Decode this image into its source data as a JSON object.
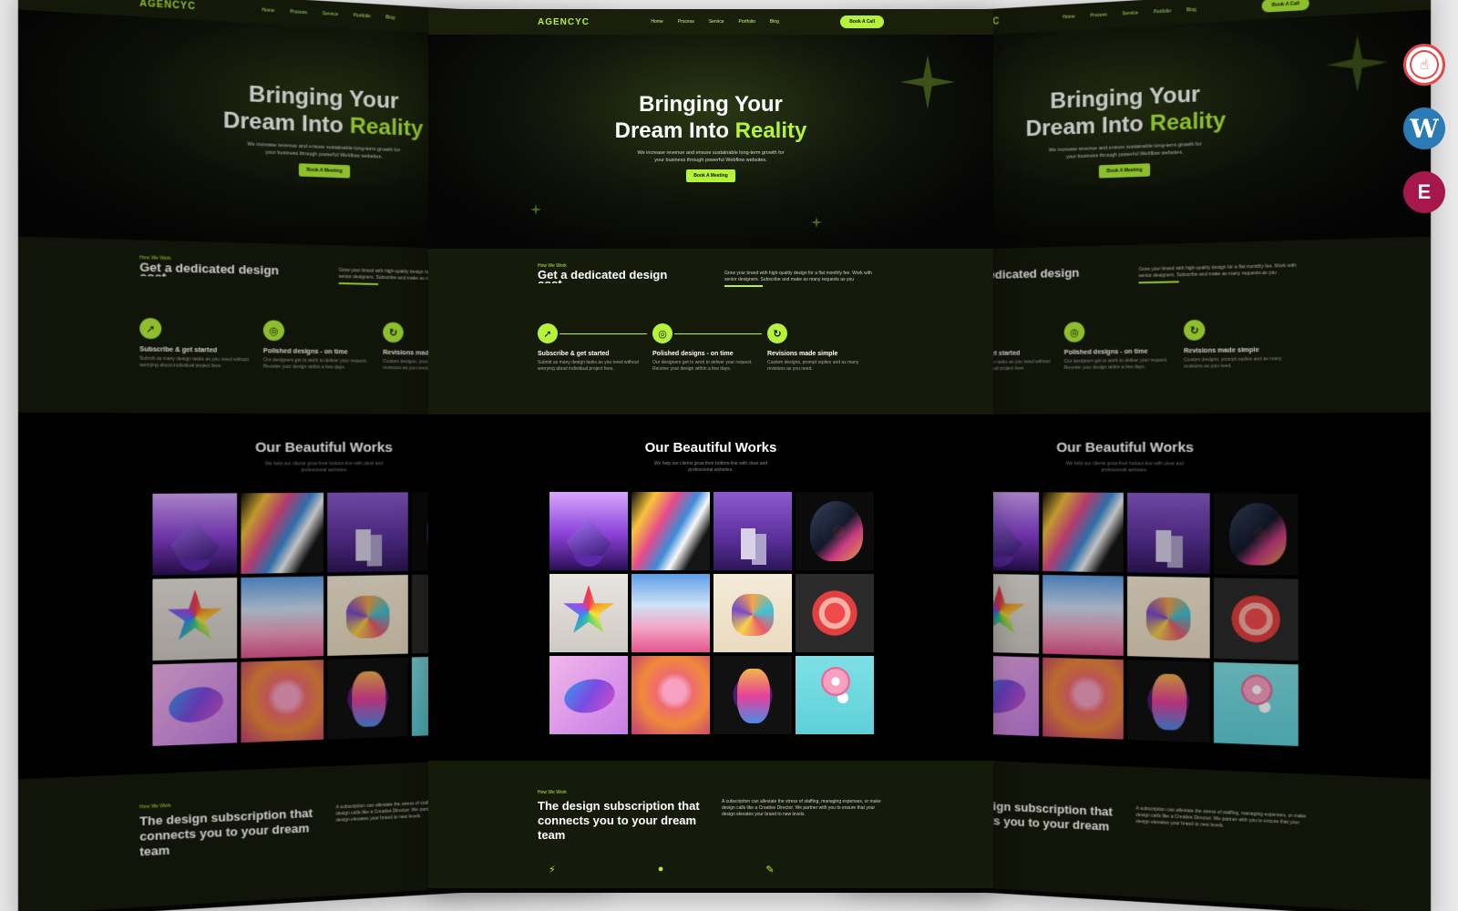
{
  "site": {
    "logo": "AGENCYC",
    "nav": [
      "Home",
      "Process",
      "Service",
      "Portfolio",
      "Blog"
    ],
    "cta": "Book A Call"
  },
  "hero": {
    "title_line1": "Bringing Your",
    "title_line2_plain": "Dream Into ",
    "title_line2_accent": "Reality",
    "subtitle": "We increase revenue and ensure sustainable long-term growth for your business through powerful Webflow websites.",
    "button": "Book A Meeting"
  },
  "how": {
    "tag": "How We Work",
    "heading": "Get a dedicated design cost.",
    "desc": "Grow your brand with high-quality design for a flat monthly fee. Work with senior designers. Subscribe and make as many requests as you",
    "steps": [
      {
        "title": "Subscribe & get started",
        "text": "Submit as many design tasks as you need without worrying about individual project fees."
      },
      {
        "title": "Polished designs - on time",
        "text": "Our designers get to work to deliver your request. Receive your design within a few days."
      },
      {
        "title": "Revisions made simple",
        "text": "Custom designs, prompt replies and as many revisions as you need."
      }
    ]
  },
  "works": {
    "title": "Our Beautiful Works",
    "subtitle": "We help our clients grow their bottom-line with clear and professional websites."
  },
  "subscription": {
    "tag": "How We Work",
    "heading": "The design subscription that connects you to your dream team",
    "desc": "A subscription can alleviate the stress of staffing, managing expenses, or make design calls like a Creative Director. We partner with you to ensure that your design elevates your brand to new levels."
  },
  "colors": {
    "accent": "#b4f33a",
    "background": "#050505",
    "section": "#161a0b"
  },
  "badges": [
    "webflow-icon",
    "wordpress-icon",
    "elementor-icon"
  ]
}
